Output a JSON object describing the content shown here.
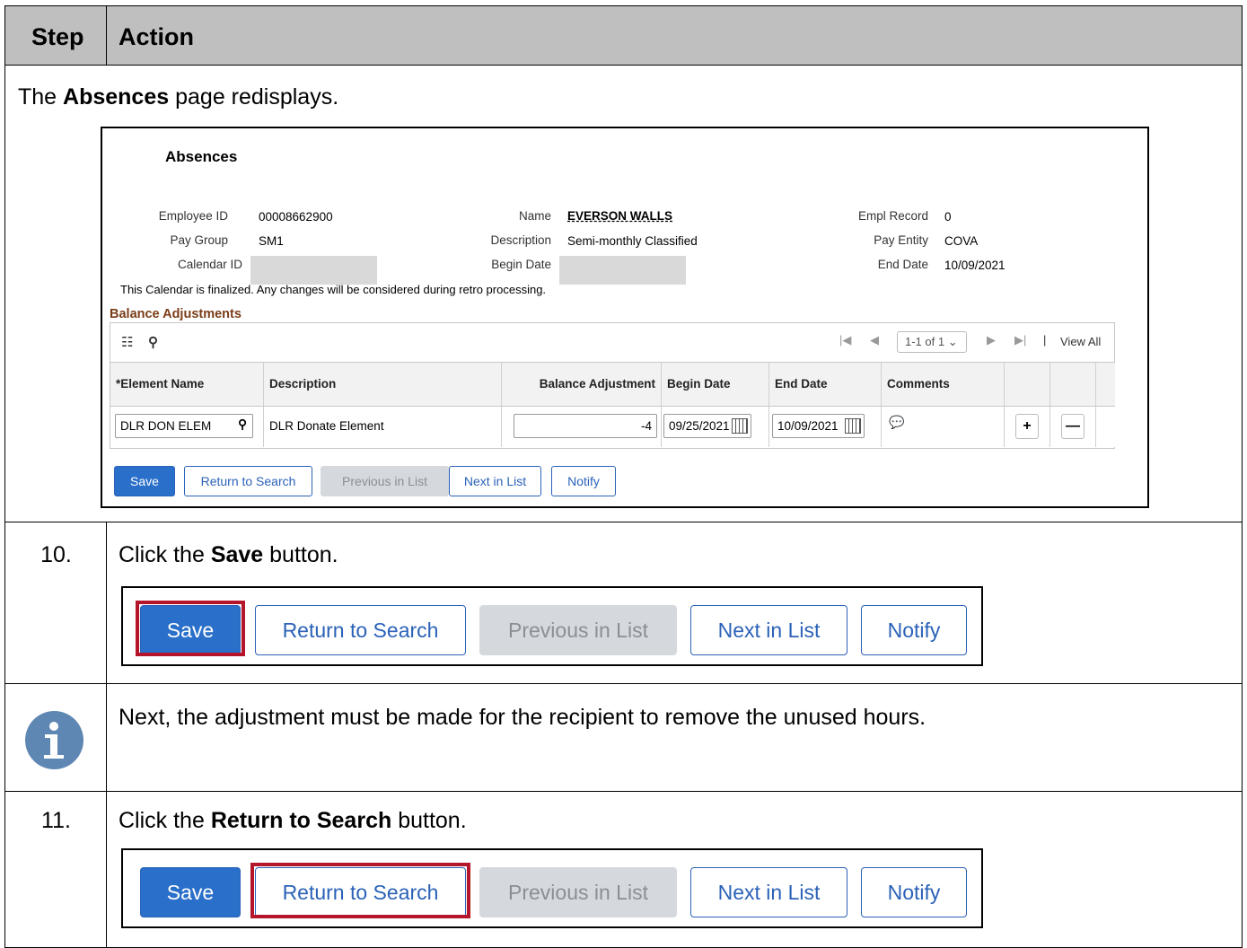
{
  "header": {
    "step": "Step",
    "action": "Action"
  },
  "intro": {
    "pre": "The ",
    "bold": "Absences",
    "post": " page redisplays."
  },
  "absences": {
    "title": "Absences",
    "fields": {
      "employee_id_label": "Employee ID",
      "employee_id": "00008662900",
      "name_label": "Name",
      "name": "EVERSON WALLS",
      "empl_record_label": "Empl Record",
      "empl_record": "0",
      "pay_group_label": "Pay Group",
      "pay_group": "SM1",
      "description_label": "Description",
      "description": "Semi-monthly Classified",
      "pay_entity_label": "Pay Entity",
      "pay_entity": "COVA",
      "calendar_id_label": "Calendar ID",
      "begin_date_label": "Begin Date",
      "end_date_label": "End Date",
      "end_date": "10/09/2021"
    },
    "note": "This Calendar is finalized. Any changes will be considered during retro processing.",
    "section": "Balance Adjustments",
    "pager": {
      "range": "1-1 of 1",
      "view_all": "View All"
    },
    "columns": [
      "*Element Name",
      "Description",
      "Balance Adjustment",
      "Begin Date",
      "End Date",
      "Comments"
    ],
    "row": {
      "element_name": "DLR DON ELEM",
      "description": "DLR Donate Element",
      "balance_adjustment": "-4",
      "begin_date": "09/25/2021",
      "end_date": "10/09/2021"
    },
    "buttons": {
      "save": "Save",
      "return": "Return to Search",
      "previous": "Previous in List",
      "next": "Next in List",
      "notify": "Notify"
    }
  },
  "step10": {
    "num": "10.",
    "pre": "Click the ",
    "bold": "Save",
    "post": " button."
  },
  "info": {
    "text": "Next, the adjustment must be made for the recipient to remove the unused hours."
  },
  "step11": {
    "num": "11.",
    "pre": "Click the ",
    "bold": "Return to Search",
    "post": " button."
  },
  "big_buttons": {
    "save": "Save",
    "return": "Return to Search",
    "previous": "Previous in List",
    "next": "Next in List",
    "notify": "Notify"
  },
  "colors": {
    "header_bg": "#bfbfbf",
    "primary": "#2a6fc9",
    "highlight": "#b4152b",
    "section": "#7a3c18",
    "info_icon": "#5f87b3"
  }
}
